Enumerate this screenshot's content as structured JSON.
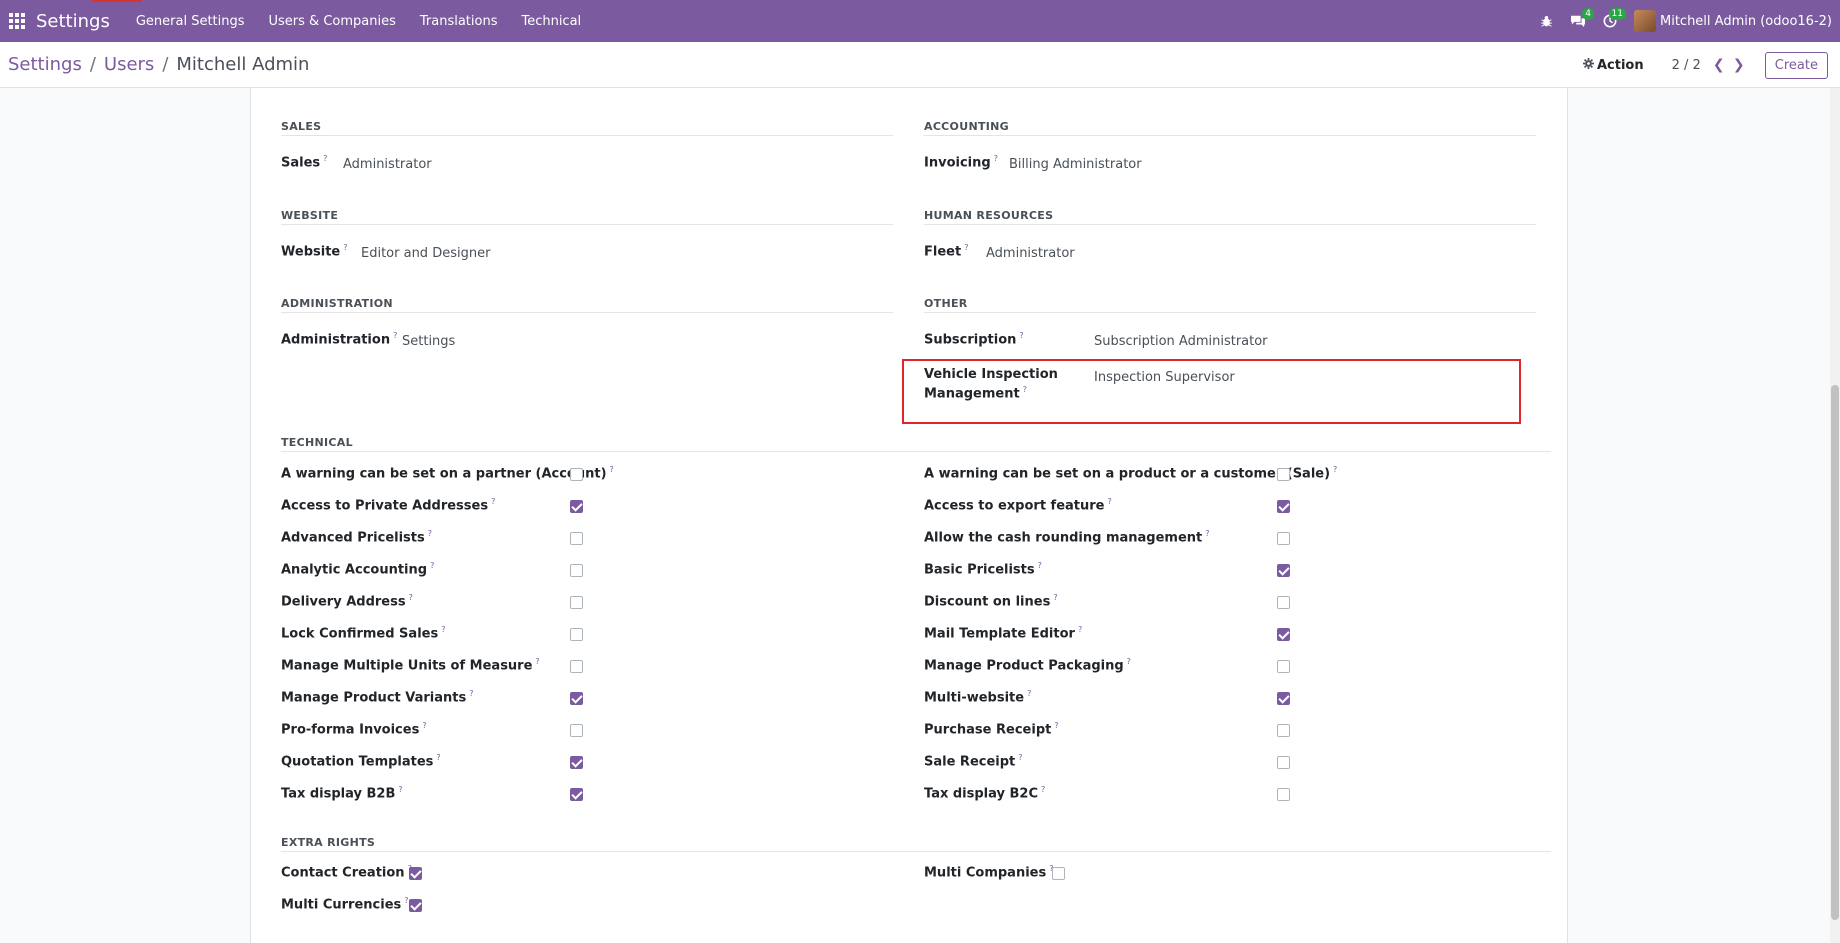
{
  "navbar": {
    "brand": "Settings",
    "menu": [
      "General Settings",
      "Users & Companies",
      "Translations",
      "Technical"
    ],
    "chat_badge": "4",
    "activity_badge": "11",
    "user": "Mitchell Admin (odoo16-2)"
  },
  "breadcrumb": {
    "root": "Settings",
    "mid": "Users",
    "current": "Mitchell Admin"
  },
  "control": {
    "action_label": "Action",
    "pager": "2 / 2",
    "create_label": "Create"
  },
  "sections": {
    "sales": {
      "title": "SALES",
      "label": "Sales",
      "value": "Administrator"
    },
    "accounting": {
      "title": "ACCOUNTING",
      "label": "Invoicing",
      "value": "Billing Administrator"
    },
    "website": {
      "title": "WEBSITE",
      "label": "Website",
      "value": "Editor and Designer"
    },
    "hr": {
      "title": "HUMAN RESOURCES",
      "label": "Fleet",
      "value": "Administrator"
    },
    "administration": {
      "title": "ADMINISTRATION",
      "label": "Administration",
      "value": "Settings"
    },
    "other": {
      "title": "OTHER",
      "sub_label": "Subscription",
      "sub_value": "Subscription Administrator",
      "vim_label_1": "Vehicle Inspection",
      "vim_label_2": "Management",
      "vim_value": "Inspection Supervisor"
    }
  },
  "technical": {
    "title": "TECHNICAL",
    "left": [
      {
        "label": "A warning can be set on a partner (Account)",
        "checked": false
      },
      {
        "label": "Access to Private Addresses",
        "checked": true
      },
      {
        "label": "Advanced Pricelists",
        "checked": false
      },
      {
        "label": "Analytic Accounting",
        "checked": false
      },
      {
        "label": "Delivery Address",
        "checked": false
      },
      {
        "label": "Lock Confirmed Sales",
        "checked": false
      },
      {
        "label": "Manage Multiple Units of Measure",
        "checked": false
      },
      {
        "label": "Manage Product Variants",
        "checked": true
      },
      {
        "label": "Pro-forma Invoices",
        "checked": false
      },
      {
        "label": "Quotation Templates",
        "checked": true
      },
      {
        "label": "Tax display B2B",
        "checked": true
      }
    ],
    "right": [
      {
        "label": "A warning can be set on a product or a customer (Sale)",
        "checked": false
      },
      {
        "label": "Access to export feature",
        "checked": true
      },
      {
        "label": "Allow the cash rounding management",
        "checked": false
      },
      {
        "label": "Basic Pricelists",
        "checked": true
      },
      {
        "label": "Discount on lines",
        "checked": false
      },
      {
        "label": "Mail Template Editor",
        "checked": true
      },
      {
        "label": "Manage Product Packaging",
        "checked": false
      },
      {
        "label": "Multi-website",
        "checked": true
      },
      {
        "label": "Purchase Receipt",
        "checked": false
      },
      {
        "label": "Sale Receipt",
        "checked": false
      },
      {
        "label": "Tax display B2C",
        "checked": false
      }
    ]
  },
  "extra_rights": {
    "title": "EXTRA RIGHTS",
    "left": [
      {
        "label": "Contact Creation",
        "checked": true
      },
      {
        "label": "Multi Currencies",
        "checked": true
      }
    ],
    "right": [
      {
        "label": "Multi Companies",
        "checked": false
      }
    ]
  },
  "help_mark": "?"
}
